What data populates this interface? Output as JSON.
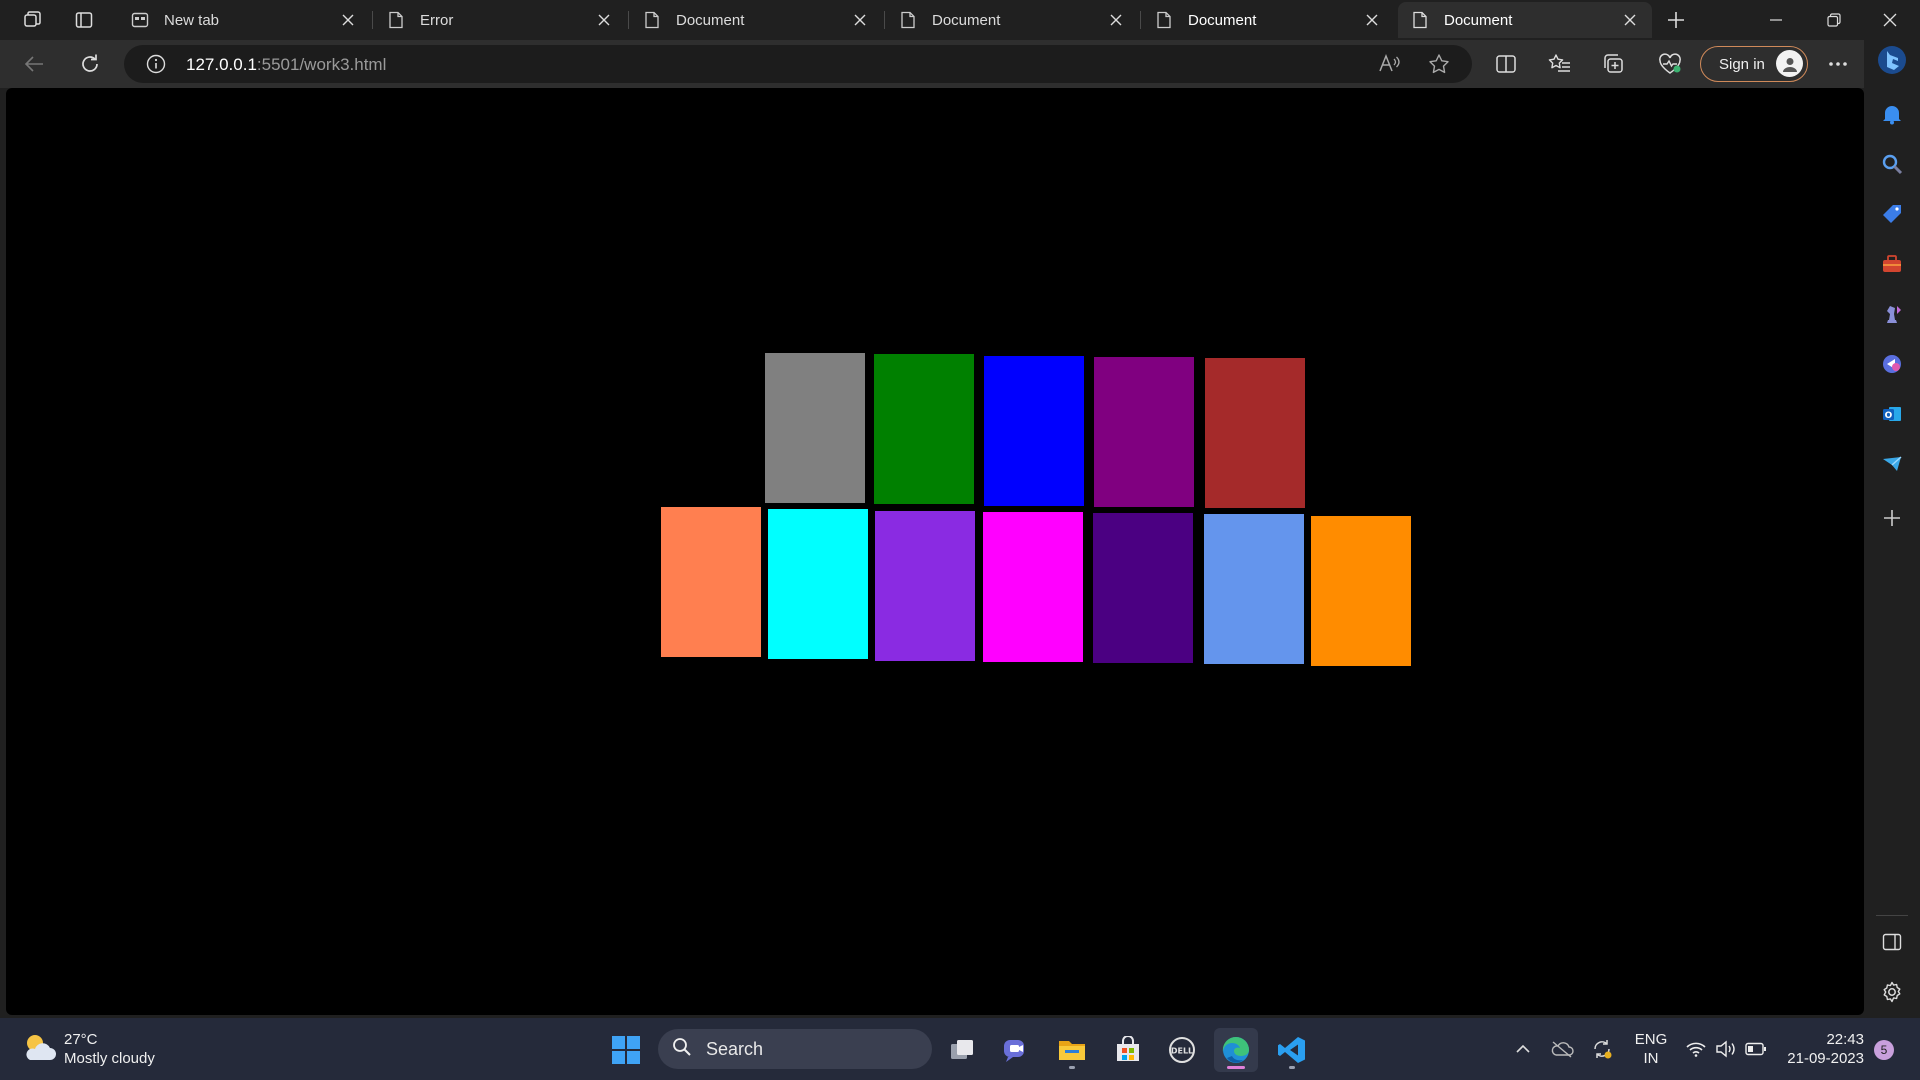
{
  "browser": {
    "tabs": [
      {
        "title": "New tab",
        "icon": "newtab-icon",
        "active": false
      },
      {
        "title": "Error",
        "icon": "page-icon",
        "active": false
      },
      {
        "title": "Document",
        "icon": "page-icon",
        "active": false
      },
      {
        "title": "Document",
        "icon": "page-icon",
        "active": false
      },
      {
        "title": "Document",
        "icon": "page-icon",
        "active": false
      },
      {
        "title": "Document",
        "icon": "page-icon",
        "active": true
      }
    ],
    "url_host": "127.0.0.1",
    "url_rest": ":5501/work3.html",
    "signin_label": "Sign in"
  },
  "page": {
    "background": "#000000",
    "boxes_row1": [
      "#808080",
      "#008000",
      "#0000ff",
      "#800080",
      "#a52a2a"
    ],
    "boxes_row2": [
      "#ff7f50",
      "#00ffff",
      "#8a2be2",
      "#ff00ff",
      "#4b0082",
      "#6495ed",
      "#ff8c00"
    ]
  },
  "sidebar": {
    "items": [
      "bell-icon",
      "search-icon",
      "tag-icon",
      "toolbox-icon",
      "chess-icon",
      "copilot-icon",
      "outlook-icon",
      "send-icon",
      "add-icon"
    ]
  },
  "taskbar": {
    "weather_temp": "27°C",
    "weather_desc": "Mostly cloudy",
    "search_label": "Search",
    "lang_top": "ENG",
    "lang_bottom": "IN",
    "time": "22:43",
    "date": "21-09-2023",
    "notification_count": "5"
  }
}
